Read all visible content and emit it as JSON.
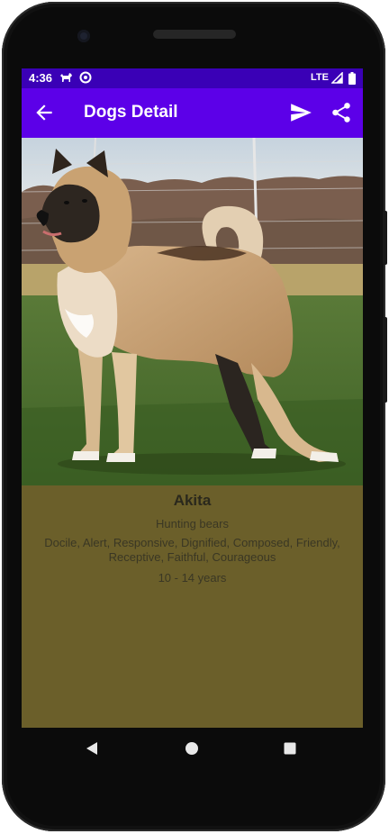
{
  "status_bar": {
    "time": "4:36",
    "network": "LTE"
  },
  "app_bar": {
    "title": "Dogs Detail",
    "background": "#5c00e8"
  },
  "dog": {
    "name": "Akita",
    "bred_for": "Hunting bears",
    "temperament": "Docile, Alert, Responsive, Dignified, Composed, Friendly, Receptive, Faithful, Courageous",
    "life_span": "10 - 14 years"
  },
  "colors": {
    "status_bar": "#3a00b6",
    "detail_background": "#6b5f2a"
  },
  "icons": {
    "back": "arrow-back-icon",
    "send": "send-icon",
    "share": "share-icon",
    "nav_back": "triangle-back-icon",
    "nav_home": "circle-home-icon",
    "nav_recents": "square-recents-icon"
  }
}
